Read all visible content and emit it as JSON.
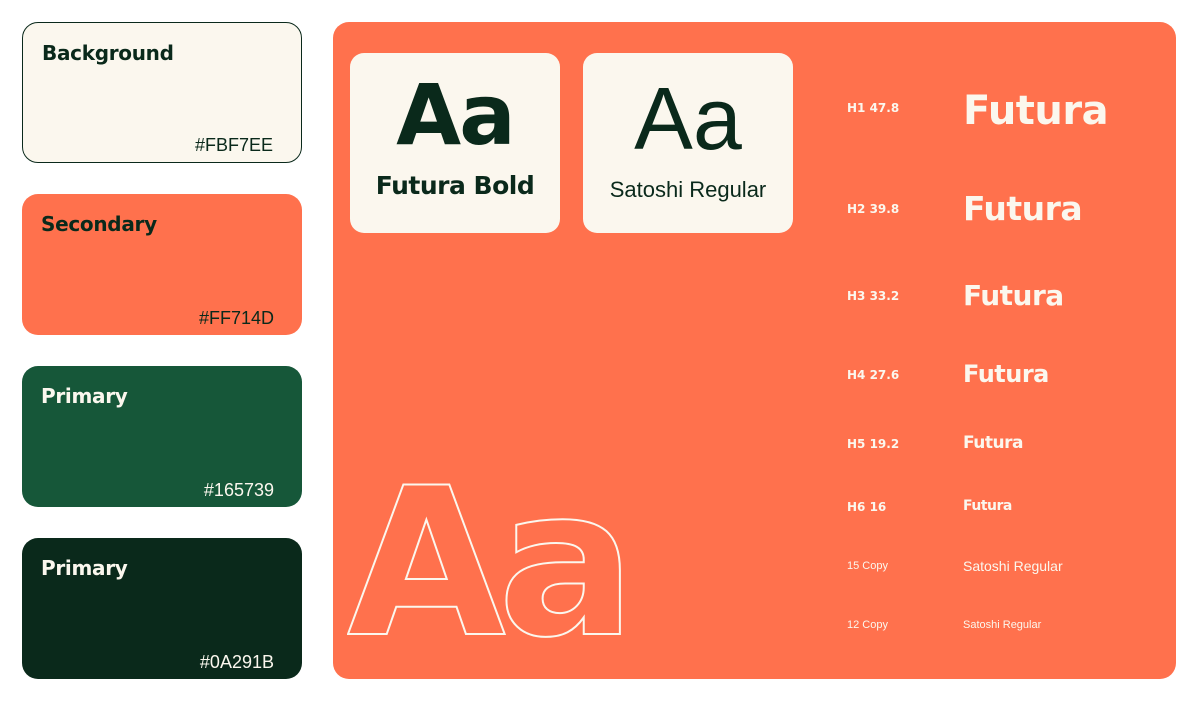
{
  "palette": [
    {
      "name": "Background",
      "hex": "#FBF7EE"
    },
    {
      "name": "Secondary",
      "hex": "#FF714D"
    },
    {
      "name": "Primary",
      "hex": "#165739"
    },
    {
      "name": "Primary",
      "hex": "#0A291B"
    }
  ],
  "typefaces": {
    "bold": {
      "sample": "Aa",
      "label": "Futura Bold"
    },
    "regular": {
      "sample": "Aa",
      "label": "Satoshi Regular"
    },
    "outline_sample": "Aa"
  },
  "type_scale": [
    {
      "tag": "H1 47.8",
      "sample": "Futura"
    },
    {
      "tag": "H2 39.8",
      "sample": "Futura"
    },
    {
      "tag": "H3 33.2",
      "sample": "Futura"
    },
    {
      "tag": "H4 27.6",
      "sample": "Futura"
    },
    {
      "tag": "H5 19.2",
      "sample": "Futura"
    },
    {
      "tag": "H6 16",
      "sample": "Futura"
    },
    {
      "tag": "15 Copy",
      "sample": "Satoshi Regular"
    },
    {
      "tag": "12 Copy",
      "sample": "Satoshi Regular"
    }
  ]
}
